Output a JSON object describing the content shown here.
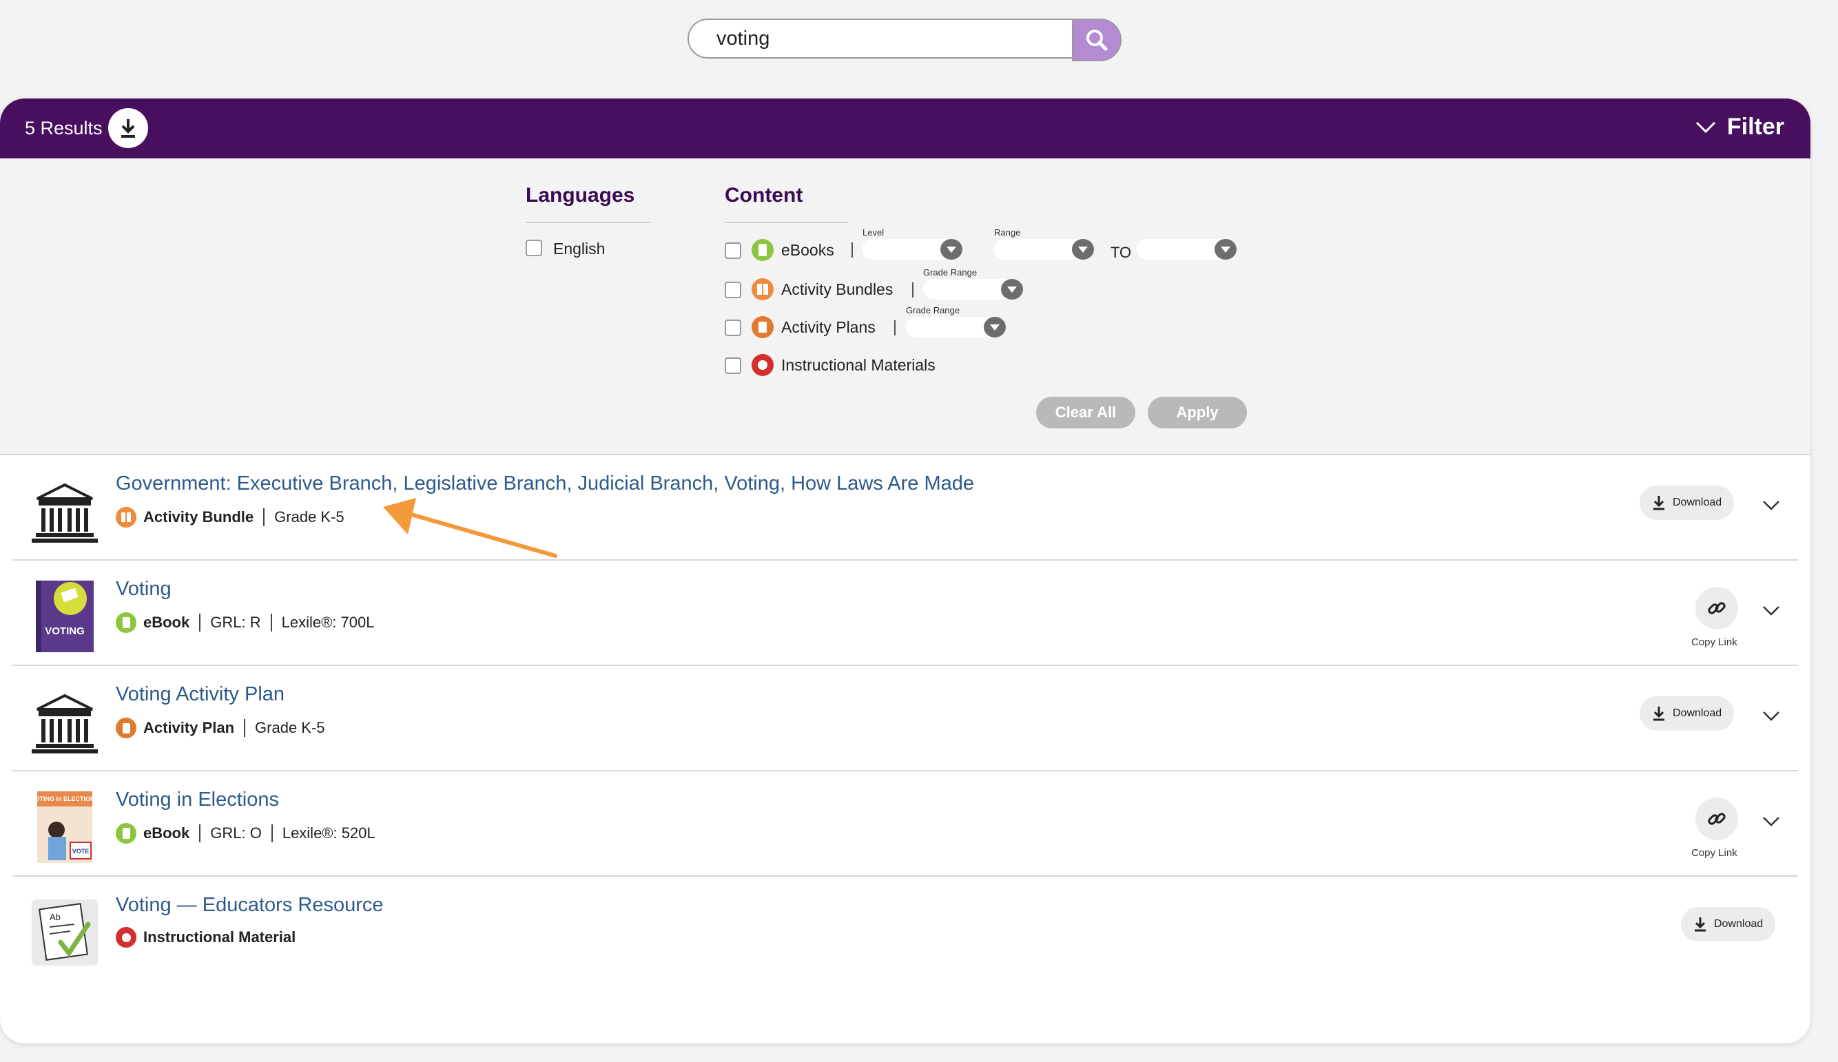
{
  "search": {
    "value": "voting"
  },
  "header": {
    "results_label": "5 Results",
    "filter_label": "Filter"
  },
  "filters": {
    "languages_title": "Languages",
    "languages": [
      "English"
    ],
    "content_title": "Content",
    "content_options": [
      {
        "label": "eBooks",
        "icon": "ebook-icon",
        "color": "#8cc63f"
      },
      {
        "label": "Activity Bundles",
        "icon": "activity-bundle-icon",
        "color": "#f08a3c"
      },
      {
        "label": "Activity Plans",
        "icon": "activity-plan-icon",
        "color": "#e07a2e"
      },
      {
        "label": "Instructional Materials",
        "icon": "apple-icon",
        "color": "#d32f2f"
      }
    ],
    "level_label": "Level",
    "range_label": "Range",
    "to_label": "TO",
    "grade_range_label": "Grade Range",
    "clear_label": "Clear All",
    "apply_label": "Apply"
  },
  "results": [
    {
      "title": "Government: Executive Branch, Legislative Branch, Judicial Branch, Voting, How Laws Are Made",
      "type": "Activity Bundle",
      "meta": [
        "Grade K-5"
      ],
      "action": "Download",
      "thumb": "capitol-building-icon"
    },
    {
      "title": "Voting",
      "type": "eBook",
      "meta": [
        "GRL: R",
        "Lexile®: 700L"
      ],
      "action": "Copy Link",
      "thumb": "voting-book-cover",
      "cover_text": "VOTING"
    },
    {
      "title": "Voting Activity Plan",
      "type": "Activity Plan",
      "meta": [
        "Grade K-5"
      ],
      "action": "Download",
      "thumb": "capitol-building-icon"
    },
    {
      "title": "Voting in Elections",
      "type": "eBook",
      "meta": [
        "GRL: O",
        "Lexile®: 520L"
      ],
      "action": "Copy Link",
      "thumb": "voting-in-elections-cover",
      "cover_text": "VOTING in ELECTIONS",
      "cover_badge": "VOTE"
    },
    {
      "title": "Voting — Educators Resource",
      "type": "Instructional Material",
      "meta": [],
      "action": "Download",
      "thumb": "worksheet-check-icon",
      "thumb_text": "Ab"
    }
  ],
  "colors": {
    "brand_purple": "#470f5e",
    "search_button": "#b48ad0",
    "title_link": "#2d5a8a",
    "annotation_arrow": "#f29a3a"
  }
}
